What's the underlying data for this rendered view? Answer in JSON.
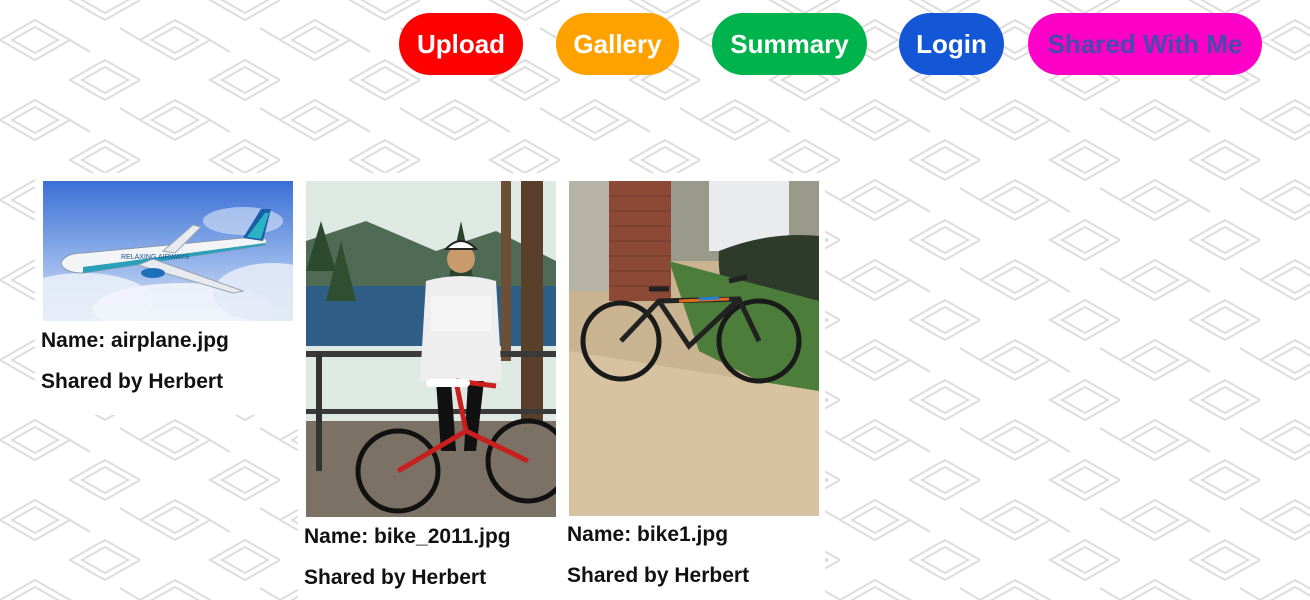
{
  "colors": {
    "upload": "#ff0000",
    "gallery": "#ffa200",
    "summary": "#00b34d",
    "login": "#1457d6",
    "shared": "#ff00c8",
    "shared_text": "#4a4aa8",
    "pattern_stroke": "#d9d9d9"
  },
  "nav": {
    "upload_label": "Upload",
    "gallery_label": "Gallery",
    "summary_label": "Summary",
    "login_label": "Login",
    "shared_label": "Shared With Me"
  },
  "items": [
    {
      "name": "Name: airplane.jpg",
      "shared_by": "Shared by Herbert",
      "image": "airplane-photo"
    },
    {
      "name": "Name: bike_2011.jpg",
      "shared_by": "Shared by Herbert",
      "image": "cyclist-photo"
    },
    {
      "name": "Name: bike1.jpg",
      "shared_by": "Shared by Herbert",
      "image": "bicycle-photo"
    }
  ]
}
